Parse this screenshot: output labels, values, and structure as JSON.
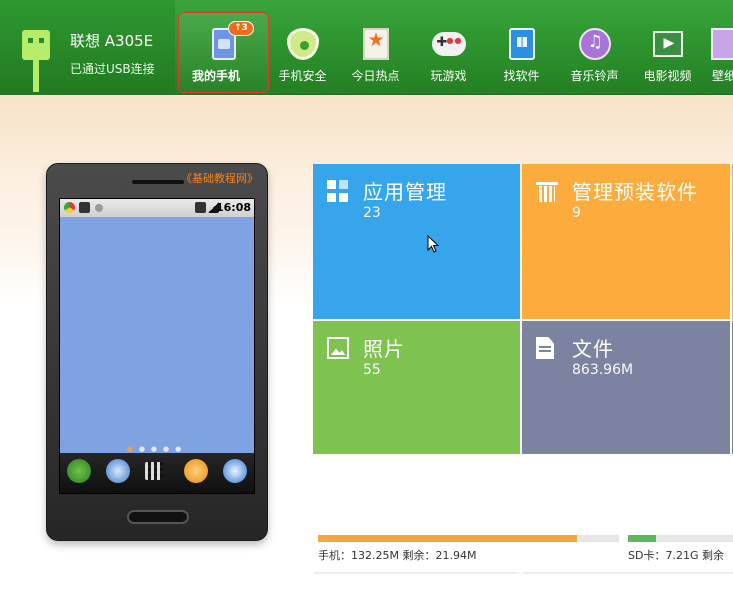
{
  "device": {
    "name": "联想 A305E",
    "status": "已通过USB连接"
  },
  "nav": [
    {
      "label": "我的手机",
      "icon": "phone-icon",
      "badge": "↑3",
      "active": true
    },
    {
      "label": "手机安全",
      "icon": "shield-icon"
    },
    {
      "label": "今日热点",
      "icon": "hot-star-icon"
    },
    {
      "label": "玩游戏",
      "icon": "gamepad-icon"
    },
    {
      "label": "找软件",
      "icon": "app-store-icon"
    },
    {
      "label": "音乐铃声",
      "icon": "music-icon"
    },
    {
      "label": "电影视频",
      "icon": "movie-icon"
    },
    {
      "label": "壁纸",
      "icon": "wallpaper-icon"
    }
  ],
  "phone_preview": {
    "watermark": "《基础教程网》",
    "time": "16:08"
  },
  "tiles": {
    "apps": {
      "title": "应用管理",
      "count": "23",
      "color": "#36a5ec"
    },
    "preinstalled": {
      "title": "管理预装软件",
      "count": "9",
      "color": "#fbac3c"
    },
    "photos": {
      "title": "照片",
      "count": "55",
      "color": "#7ec250"
    },
    "files": {
      "title": "文件",
      "count": "863.96M",
      "color": "#7b83a1"
    }
  },
  "storage": {
    "phone": {
      "label": "手机：132.25M   剩余：21.94M",
      "used_fraction": 0.86,
      "color": "#f3a73b"
    },
    "sd": {
      "label": "SD卡：7.21G   剩余",
      "used_fraction": 0.27,
      "color": "#5cb85c"
    }
  }
}
